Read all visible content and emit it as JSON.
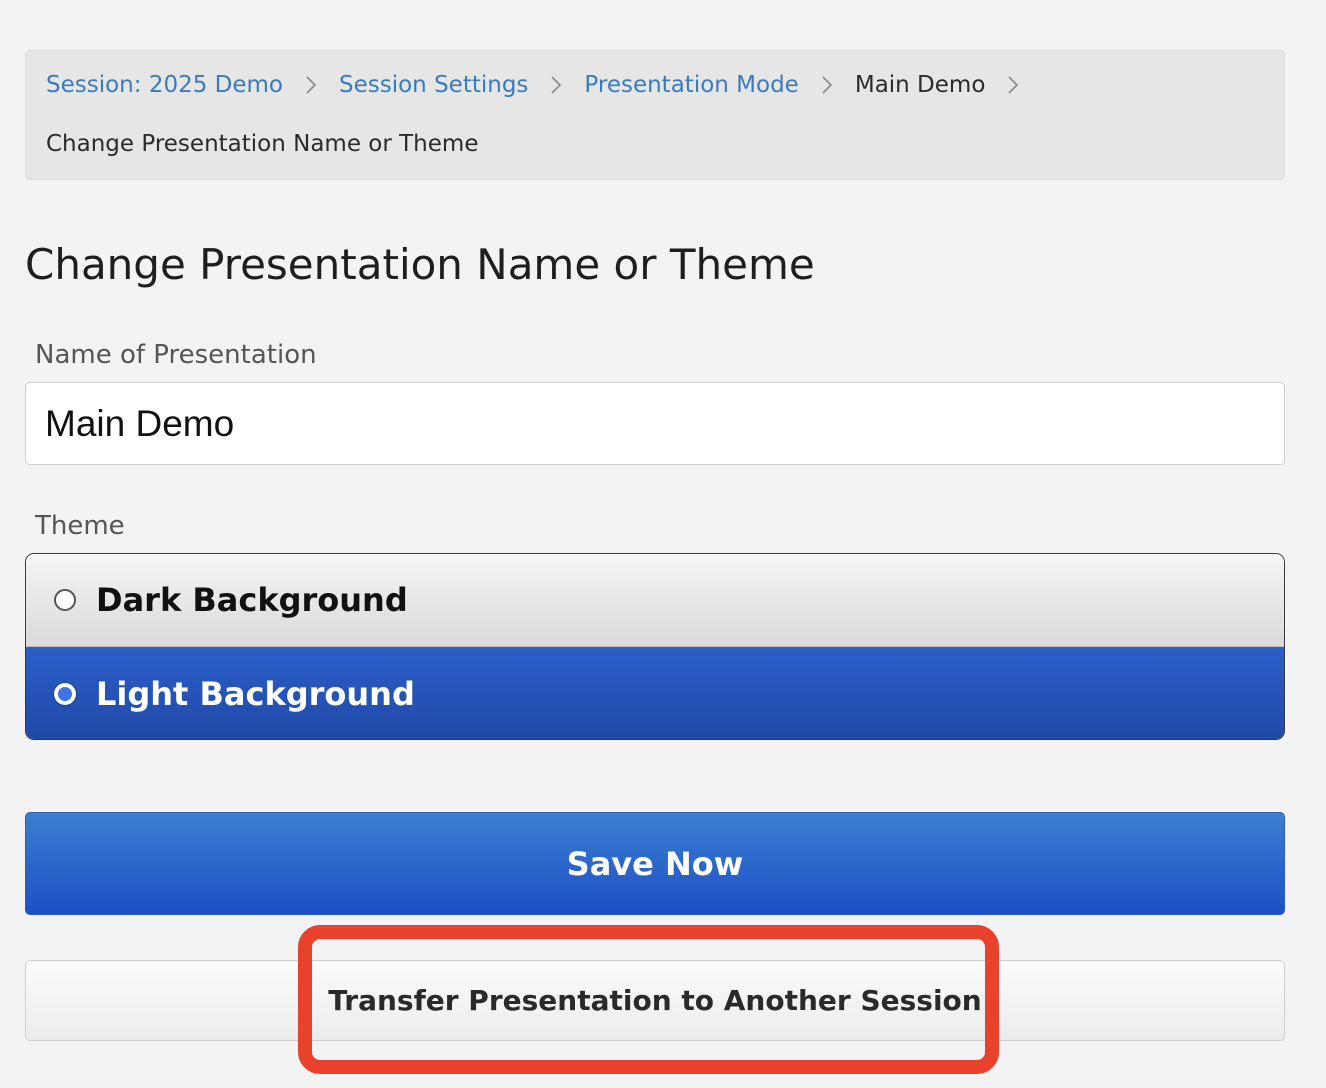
{
  "breadcrumb": {
    "items": [
      {
        "label": "Session: 2025 Demo",
        "type": "link"
      },
      {
        "label": "Session Settings",
        "type": "link"
      },
      {
        "label": "Presentation Mode",
        "type": "link"
      },
      {
        "label": "Main Demo",
        "type": "text"
      }
    ],
    "current": "Change Presentation Name or Theme"
  },
  "page": {
    "title": "Change Presentation Name or Theme"
  },
  "form": {
    "name_label": "Name of Presentation",
    "name_value": "Main Demo",
    "theme_label": "Theme",
    "theme_options": [
      {
        "label": "Dark Background",
        "selected": false
      },
      {
        "label": "Light Background",
        "selected": true
      }
    ],
    "save_label": "Save Now",
    "transfer_label": "Transfer Presentation to Another Session"
  },
  "colors": {
    "accent": "#1d4fc6",
    "link": "#3a7bbf",
    "highlight": "#e8412c"
  },
  "icons": [
    "chevron-right-icon"
  ]
}
